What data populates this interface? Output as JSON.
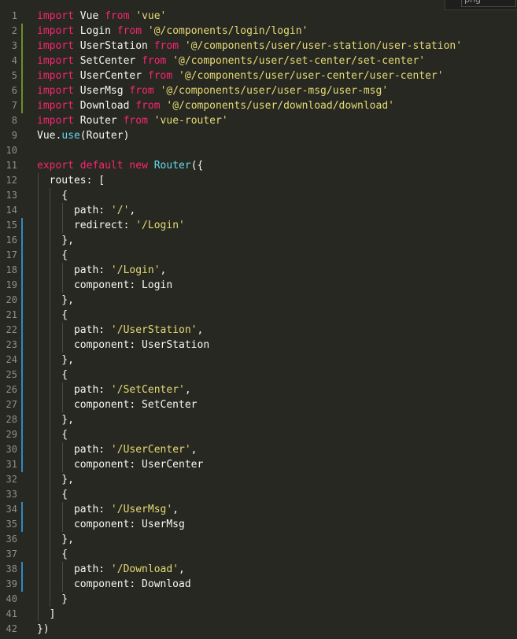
{
  "top_tab": {
    "label": "png"
  },
  "editor": {
    "lines": [
      {
        "number": "1",
        "marker": "",
        "guides": 0,
        "tokens": [
          {
            "t": "import",
            "k": "kw"
          },
          {
            "t": " Vue ",
            "k": "plain"
          },
          {
            "t": "from",
            "k": "kw"
          },
          {
            "t": " ",
            "k": "plain"
          },
          {
            "t": "'vue'",
            "k": "str"
          }
        ]
      },
      {
        "number": "2",
        "marker": "added",
        "guides": 0,
        "tokens": [
          {
            "t": "import",
            "k": "kw"
          },
          {
            "t": " Login ",
            "k": "plain"
          },
          {
            "t": "from",
            "k": "kw"
          },
          {
            "t": " ",
            "k": "plain"
          },
          {
            "t": "'@/components/login/login'",
            "k": "str"
          }
        ]
      },
      {
        "number": "3",
        "marker": "added",
        "guides": 0,
        "tokens": [
          {
            "t": "import",
            "k": "kw"
          },
          {
            "t": " UserStation ",
            "k": "plain"
          },
          {
            "t": "from",
            "k": "kw"
          },
          {
            "t": " ",
            "k": "plain"
          },
          {
            "t": "'@/components/user/user-station/user-station'",
            "k": "str"
          }
        ]
      },
      {
        "number": "4",
        "marker": "added",
        "guides": 0,
        "tokens": [
          {
            "t": "import",
            "k": "kw"
          },
          {
            "t": " SetCenter ",
            "k": "plain"
          },
          {
            "t": "from",
            "k": "kw"
          },
          {
            "t": " ",
            "k": "plain"
          },
          {
            "t": "'@/components/user/set-center/set-center'",
            "k": "str"
          }
        ]
      },
      {
        "number": "5",
        "marker": "added",
        "guides": 0,
        "tokens": [
          {
            "t": "import",
            "k": "kw"
          },
          {
            "t": " UserCenter ",
            "k": "plain"
          },
          {
            "t": "from",
            "k": "kw"
          },
          {
            "t": " ",
            "k": "plain"
          },
          {
            "t": "'@/components/user/user-center/user-center'",
            "k": "str"
          }
        ]
      },
      {
        "number": "6",
        "marker": "added",
        "guides": 0,
        "tokens": [
          {
            "t": "import",
            "k": "kw"
          },
          {
            "t": " UserMsg ",
            "k": "plain"
          },
          {
            "t": "from",
            "k": "kw"
          },
          {
            "t": " ",
            "k": "plain"
          },
          {
            "t": "'@/components/user/user-msg/user-msg'",
            "k": "str"
          }
        ]
      },
      {
        "number": "7",
        "marker": "added",
        "guides": 0,
        "tokens": [
          {
            "t": "import",
            "k": "kw"
          },
          {
            "t": " Download ",
            "k": "plain"
          },
          {
            "t": "from",
            "k": "kw"
          },
          {
            "t": " ",
            "k": "plain"
          },
          {
            "t": "'@/components/user/download/download'",
            "k": "str"
          }
        ]
      },
      {
        "number": "8",
        "marker": "",
        "guides": 0,
        "tokens": [
          {
            "t": "import",
            "k": "kw"
          },
          {
            "t": " Router ",
            "k": "plain"
          },
          {
            "t": "from",
            "k": "kw"
          },
          {
            "t": " ",
            "k": "plain"
          },
          {
            "t": "'vue-router'",
            "k": "str"
          }
        ]
      },
      {
        "number": "9",
        "marker": "",
        "guides": 0,
        "tokens": [
          {
            "t": "Vue.",
            "k": "plain"
          },
          {
            "t": "use",
            "k": "cls"
          },
          {
            "t": "(Router)",
            "k": "plain"
          }
        ]
      },
      {
        "number": "10",
        "marker": "",
        "guides": 0,
        "tokens": []
      },
      {
        "number": "11",
        "marker": "",
        "guides": 0,
        "tokens": [
          {
            "t": "export",
            "k": "kw"
          },
          {
            "t": " ",
            "k": "plain"
          },
          {
            "t": "default",
            "k": "kw"
          },
          {
            "t": " ",
            "k": "plain"
          },
          {
            "t": "new",
            "k": "kw"
          },
          {
            "t": " ",
            "k": "plain"
          },
          {
            "t": "Router",
            "k": "cls"
          },
          {
            "t": "({",
            "k": "plain"
          }
        ]
      },
      {
        "number": "12",
        "marker": "",
        "guides": 1,
        "tokens": [
          {
            "t": "  routes: [",
            "k": "plain"
          }
        ]
      },
      {
        "number": "13",
        "marker": "",
        "guides": 2,
        "tokens": [
          {
            "t": "    {",
            "k": "plain"
          }
        ]
      },
      {
        "number": "14",
        "marker": "",
        "guides": 3,
        "tokens": [
          {
            "t": "      path: ",
            "k": "plain"
          },
          {
            "t": "'/'",
            "k": "str"
          },
          {
            "t": ",",
            "k": "plain"
          }
        ]
      },
      {
        "number": "15",
        "marker": "modified",
        "guides": 3,
        "tokens": [
          {
            "t": "      redirect: ",
            "k": "plain"
          },
          {
            "t": "'/Login'",
            "k": "str"
          }
        ]
      },
      {
        "number": "16",
        "marker": "modified",
        "guides": 2,
        "tokens": [
          {
            "t": "    },",
            "k": "plain"
          }
        ]
      },
      {
        "number": "17",
        "marker": "modified",
        "guides": 2,
        "tokens": [
          {
            "t": "    {",
            "k": "plain"
          }
        ]
      },
      {
        "number": "18",
        "marker": "modified",
        "guides": 3,
        "tokens": [
          {
            "t": "      path: ",
            "k": "plain"
          },
          {
            "t": "'/Login'",
            "k": "str"
          },
          {
            "t": ",",
            "k": "plain"
          }
        ]
      },
      {
        "number": "19",
        "marker": "modified",
        "guides": 3,
        "tokens": [
          {
            "t": "      component: Login",
            "k": "plain"
          }
        ]
      },
      {
        "number": "20",
        "marker": "modified",
        "guides": 2,
        "tokens": [
          {
            "t": "    },",
            "k": "plain"
          }
        ]
      },
      {
        "number": "21",
        "marker": "modified",
        "guides": 2,
        "tokens": [
          {
            "t": "    {",
            "k": "plain"
          }
        ]
      },
      {
        "number": "22",
        "marker": "modified",
        "guides": 3,
        "tokens": [
          {
            "t": "      path: ",
            "k": "plain"
          },
          {
            "t": "'/UserStation'",
            "k": "str"
          },
          {
            "t": ",",
            "k": "plain"
          }
        ]
      },
      {
        "number": "23",
        "marker": "modified",
        "guides": 3,
        "tokens": [
          {
            "t": "      component: UserStation",
            "k": "plain"
          }
        ]
      },
      {
        "number": "24",
        "marker": "modified",
        "guides": 2,
        "tokens": [
          {
            "t": "    },",
            "k": "plain"
          }
        ]
      },
      {
        "number": "25",
        "marker": "modified",
        "guides": 2,
        "tokens": [
          {
            "t": "    {",
            "k": "plain"
          }
        ]
      },
      {
        "number": "26",
        "marker": "modified",
        "guides": 3,
        "tokens": [
          {
            "t": "      path: ",
            "k": "plain"
          },
          {
            "t": "'/SetCenter'",
            "k": "str"
          },
          {
            "t": ",",
            "k": "plain"
          }
        ]
      },
      {
        "number": "27",
        "marker": "modified",
        "guides": 3,
        "tokens": [
          {
            "t": "      component: SetCenter",
            "k": "plain"
          }
        ]
      },
      {
        "number": "28",
        "marker": "modified",
        "guides": 2,
        "tokens": [
          {
            "t": "    },",
            "k": "plain"
          }
        ]
      },
      {
        "number": "29",
        "marker": "modified",
        "guides": 2,
        "tokens": [
          {
            "t": "    {",
            "k": "plain"
          }
        ]
      },
      {
        "number": "30",
        "marker": "modified",
        "guides": 3,
        "tokens": [
          {
            "t": "      path: ",
            "k": "plain"
          },
          {
            "t": "'/UserCenter'",
            "k": "str"
          },
          {
            "t": ",",
            "k": "plain"
          }
        ]
      },
      {
        "number": "31",
        "marker": "modified",
        "guides": 3,
        "tokens": [
          {
            "t": "      component: UserCenter",
            "k": "plain"
          }
        ]
      },
      {
        "number": "32",
        "marker": "",
        "guides": 2,
        "tokens": [
          {
            "t": "    },",
            "k": "plain"
          }
        ]
      },
      {
        "number": "33",
        "marker": "",
        "guides": 2,
        "tokens": [
          {
            "t": "    {",
            "k": "plain"
          }
        ]
      },
      {
        "number": "34",
        "marker": "modified",
        "guides": 3,
        "tokens": [
          {
            "t": "      path: ",
            "k": "plain"
          },
          {
            "t": "'/UserMsg'",
            "k": "str"
          },
          {
            "t": ",",
            "k": "plain"
          }
        ]
      },
      {
        "number": "35",
        "marker": "modified",
        "guides": 3,
        "tokens": [
          {
            "t": "      component: UserMsg",
            "k": "plain"
          }
        ]
      },
      {
        "number": "36",
        "marker": "",
        "guides": 2,
        "tokens": [
          {
            "t": "    },",
            "k": "plain"
          }
        ]
      },
      {
        "number": "37",
        "marker": "",
        "guides": 2,
        "tokens": [
          {
            "t": "    {",
            "k": "plain"
          }
        ]
      },
      {
        "number": "38",
        "marker": "modified",
        "guides": 3,
        "tokens": [
          {
            "t": "      path: ",
            "k": "plain"
          },
          {
            "t": "'/Download'",
            "k": "str"
          },
          {
            "t": ",",
            "k": "plain"
          }
        ]
      },
      {
        "number": "39",
        "marker": "modified",
        "guides": 3,
        "tokens": [
          {
            "t": "      component: Download",
            "k": "plain"
          }
        ]
      },
      {
        "number": "40",
        "marker": "",
        "guides": 2,
        "tokens": [
          {
            "t": "    }",
            "k": "plain"
          }
        ]
      },
      {
        "number": "41",
        "marker": "",
        "guides": 1,
        "tokens": [
          {
            "t": "  ]",
            "k": "plain"
          }
        ]
      },
      {
        "number": "42",
        "marker": "",
        "guides": 0,
        "tokens": [
          {
            "t": "})",
            "k": "plain"
          }
        ]
      }
    ]
  },
  "colors": {
    "background": "#272822",
    "keyword": "#f92672",
    "string": "#e6db74",
    "function": "#66d9ef",
    "text": "#f8f8f2",
    "line_number": "#90908a",
    "added_marker": "#a6e22e",
    "modified_marker": "#2f89c5"
  }
}
